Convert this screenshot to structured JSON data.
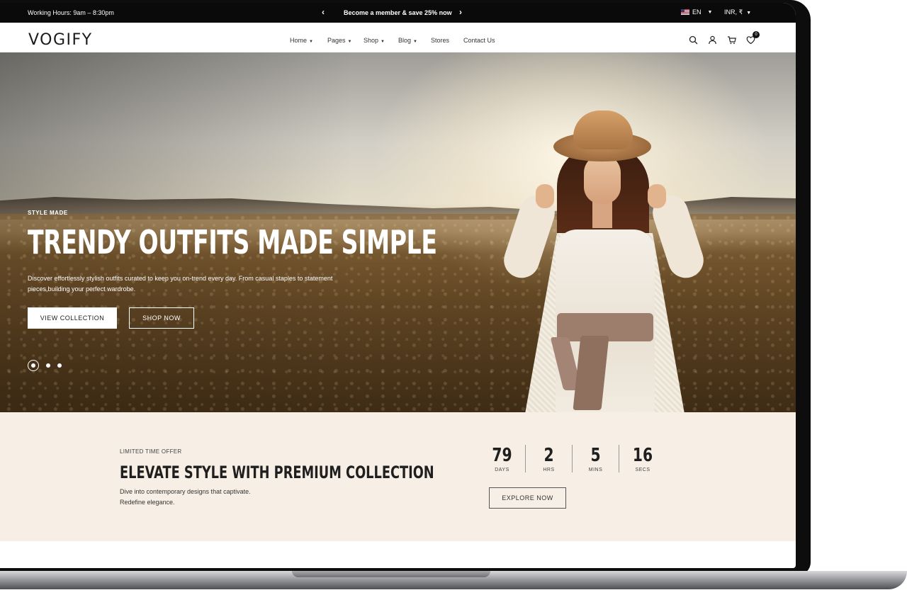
{
  "topbar": {
    "hours": "Working Hours: 9am – 8:30pm",
    "promo": "Become a member & save 25% now",
    "prev_arrow": "‹",
    "next_arrow": "›",
    "language": "EN",
    "currency": "INR, ₹"
  },
  "header": {
    "logo": "VOGIFY",
    "nav": [
      {
        "label": "Home",
        "has_dropdown": true
      },
      {
        "label": "Pages",
        "has_dropdown": true
      },
      {
        "label": "Shop",
        "has_dropdown": true
      },
      {
        "label": "Blog",
        "has_dropdown": true
      },
      {
        "label": "Stores",
        "has_dropdown": false
      },
      {
        "label": "Contact Us",
        "has_dropdown": false
      }
    ],
    "icons": [
      "search-icon",
      "user-icon",
      "cart-icon",
      "wishlist-icon"
    ],
    "wishlist_count": "0"
  },
  "hero": {
    "eyebrow": "STYLE MADE",
    "title": "TRENDY OUTFITS MADE SIMPLE",
    "description": "Discover effortlessly stylish outfits curated to keep you on-trend every day. From casual staples to statement pieces,building your perfect wardrobe.",
    "primary_button": "VIEW COLLECTION",
    "secondary_button": "SHOP NOW",
    "slides": 3,
    "active_slide": 1
  },
  "offer": {
    "eyebrow": "LIMITED TIME OFFER",
    "title": "ELEVATE STYLE WITH PREMIUM COLLECTION",
    "description_line1": "Dive into contemporary designs that captivate.",
    "description_line2": "Redefine elegance.",
    "countdown": [
      {
        "value": "79",
        "label": "DAYS"
      },
      {
        "value": "2",
        "label": "HRS"
      },
      {
        "value": "5",
        "label": "MINS"
      },
      {
        "value": "16",
        "label": "SECS"
      }
    ],
    "button": "EXPLORE NOW"
  },
  "colors": {
    "topbar_bg": "#0a0a0a",
    "offer_bg": "#f7efe5",
    "text_dark": "#1f1f1f"
  }
}
